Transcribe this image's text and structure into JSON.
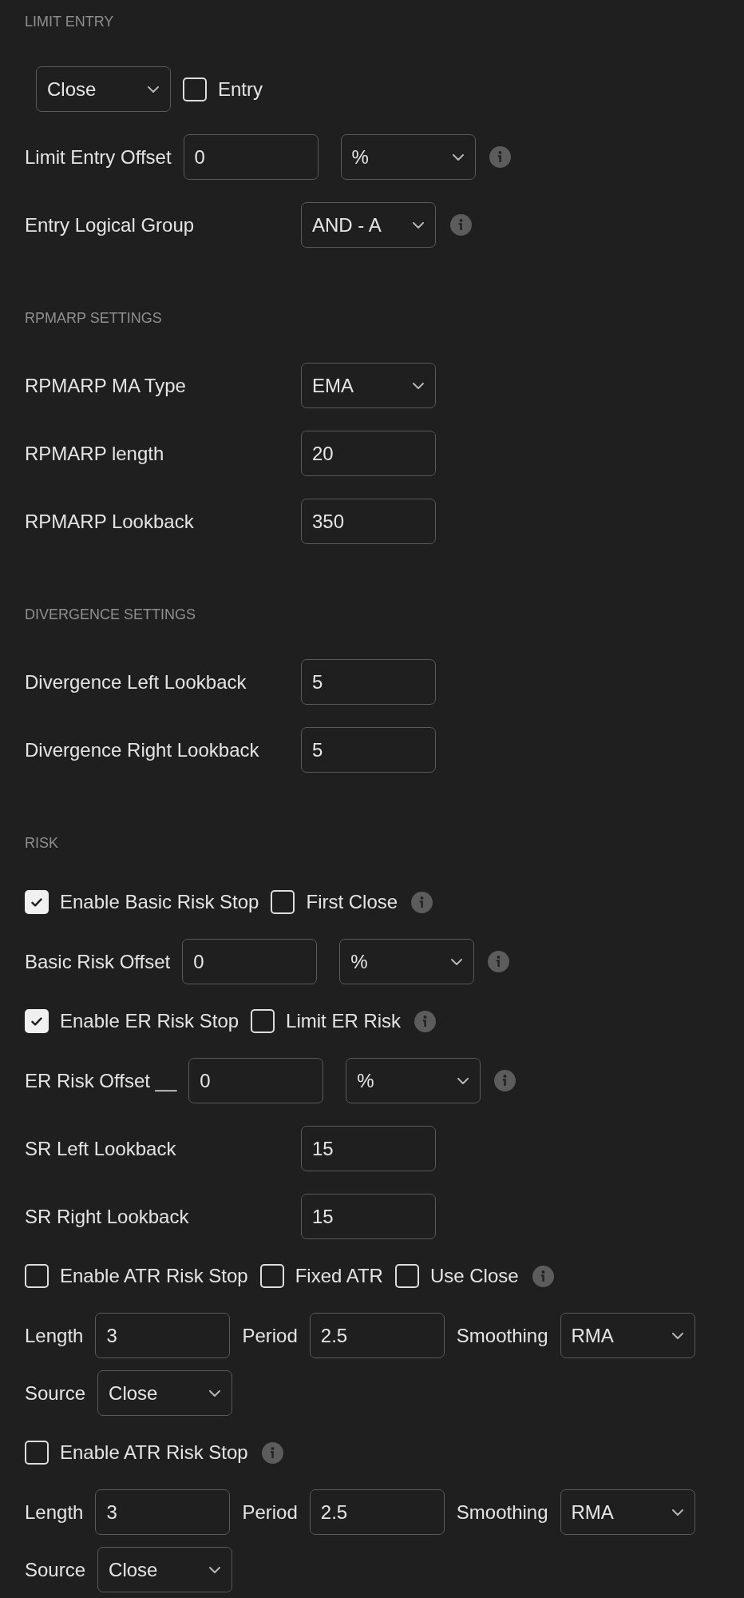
{
  "sections": [
    {
      "title": "LIMIT ENTRY",
      "rows": [
        {
          "kind": "inline",
          "items": [
            {
              "kind": "select",
              "value": "Close"
            },
            {
              "kind": "checkbox",
              "label": "Entry",
              "checked": false
            }
          ]
        },
        {
          "kind": "inline",
          "items": [
            {
              "kind": "input",
              "label": "Limit Entry Offset",
              "value": "0"
            },
            {
              "kind": "select",
              "value": "%"
            }
          ],
          "info": true
        },
        {
          "kind": "aligned",
          "label": "Entry Logical Group",
          "control": {
            "kind": "select",
            "value": "AND - A"
          },
          "info": true
        }
      ]
    },
    {
      "title": "RPMARP SETTINGS",
      "rows": [
        {
          "kind": "aligned",
          "label": "RPMARP MA Type",
          "control": {
            "kind": "select",
            "value": "EMA"
          }
        },
        {
          "kind": "aligned",
          "label": "RPMARP length",
          "control": {
            "kind": "input",
            "value": "20"
          }
        },
        {
          "kind": "aligned",
          "label": "RPMARP Lookback",
          "control": {
            "kind": "input",
            "value": "350"
          }
        }
      ]
    },
    {
      "title": "DIVERGENCE SETTINGS",
      "rows": [
        {
          "kind": "aligned",
          "label": "Divergence Left Lookback",
          "control": {
            "kind": "input",
            "value": "5"
          }
        },
        {
          "kind": "aligned",
          "label": "Divergence Right Lookback",
          "control": {
            "kind": "input",
            "value": "5"
          }
        }
      ]
    },
    {
      "title": "RISK",
      "rows": [
        {
          "kind": "inline",
          "items": [
            {
              "kind": "checkbox",
              "label": "Enable Basic Risk Stop",
              "checked": true
            },
            {
              "kind": "checkbox",
              "label": "First Close",
              "checked": false
            }
          ],
          "info": true
        },
        {
          "kind": "inline",
          "items": [
            {
              "kind": "input",
              "label": "Basic Risk Offset",
              "value": "0"
            },
            {
              "kind": "select",
              "value": "%"
            }
          ],
          "info": true
        },
        {
          "kind": "inline",
          "items": [
            {
              "kind": "checkbox",
              "label": "Enable ER Risk Stop",
              "checked": true
            },
            {
              "kind": "checkbox",
              "label": "Limit ER Risk",
              "checked": false
            }
          ],
          "info": true
        },
        {
          "kind": "inline",
          "items": [
            {
              "kind": "input",
              "label": "ER Risk Offset __",
              "value": "0"
            },
            {
              "kind": "select",
              "value": "%"
            }
          ],
          "info": true
        },
        {
          "kind": "aligned",
          "label": "SR Left Lookback",
          "control": {
            "kind": "input",
            "value": "15"
          }
        },
        {
          "kind": "aligned",
          "label": "SR Right Lookback",
          "control": {
            "kind": "input",
            "value": "15"
          }
        },
        {
          "kind": "inline",
          "items": [
            {
              "kind": "checkbox",
              "label": "Enable ATR Risk Stop",
              "checked": false
            },
            {
              "kind": "checkbox",
              "label": "Fixed ATR",
              "checked": false
            },
            {
              "kind": "checkbox",
              "label": "Use Close",
              "checked": false
            }
          ],
          "info": true
        },
        {
          "kind": "inline",
          "items": [
            {
              "kind": "input",
              "label": "Length",
              "value": "3"
            },
            {
              "kind": "input",
              "label": "Period",
              "value": "2.5"
            },
            {
              "kind": "select",
              "label": "Smoothing",
              "value": "RMA"
            },
            {
              "kind": "select",
              "label": "Source",
              "value": "Close"
            }
          ]
        },
        {
          "kind": "inline",
          "items": [
            {
              "kind": "checkbox",
              "label": "Enable ATR Risk Stop",
              "checked": false
            }
          ],
          "info": true
        },
        {
          "kind": "inline",
          "items": [
            {
              "kind": "input",
              "label": "Length",
              "value": "3"
            },
            {
              "kind": "input",
              "label": "Period",
              "value": "2.5"
            },
            {
              "kind": "select",
              "label": "Smoothing",
              "value": "RMA"
            },
            {
              "kind": "select",
              "label": "Source",
              "value": "Close"
            }
          ]
        }
      ]
    }
  ]
}
